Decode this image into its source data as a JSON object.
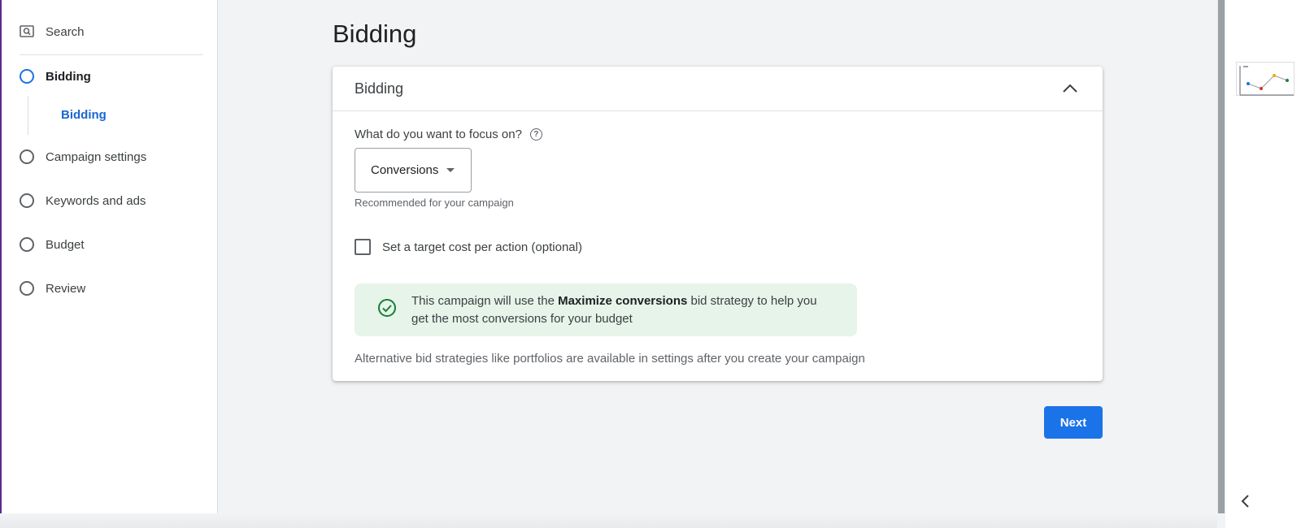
{
  "sidebar": {
    "search_label": "Search",
    "steps": [
      {
        "label": "Bidding",
        "active": true
      },
      {
        "label": "Campaign settings",
        "active": false
      },
      {
        "label": "Keywords and ads",
        "active": false
      },
      {
        "label": "Budget",
        "active": false
      },
      {
        "label": "Review",
        "active": false
      }
    ],
    "sub_item": "Bidding"
  },
  "main": {
    "page_title": "Bidding",
    "card": {
      "title": "Bidding",
      "question": "What do you want to focus on?",
      "help_glyph": "?",
      "dropdown_value": "Conversions",
      "helper_text": "Recommended for your campaign",
      "checkbox_label": "Set a target cost per action (optional)",
      "info": {
        "prefix": "This campaign will use the ",
        "strategy": "Maximize conversions",
        "suffix": " bid strategy to help you get the most conversions for your budget"
      },
      "alt_text": "Alternative bid strategies like portfolios are available in settings after you create your campaign"
    },
    "next_label": "Next"
  },
  "colors": {
    "accent": "#1a73e8",
    "success_bg": "#e6f4ea",
    "success_icon": "#188038"
  },
  "icons": [
    "search-icon",
    "chevron-up-icon",
    "help-icon",
    "dropdown-caret-icon",
    "check-circle-icon",
    "chevron-left-icon"
  ]
}
